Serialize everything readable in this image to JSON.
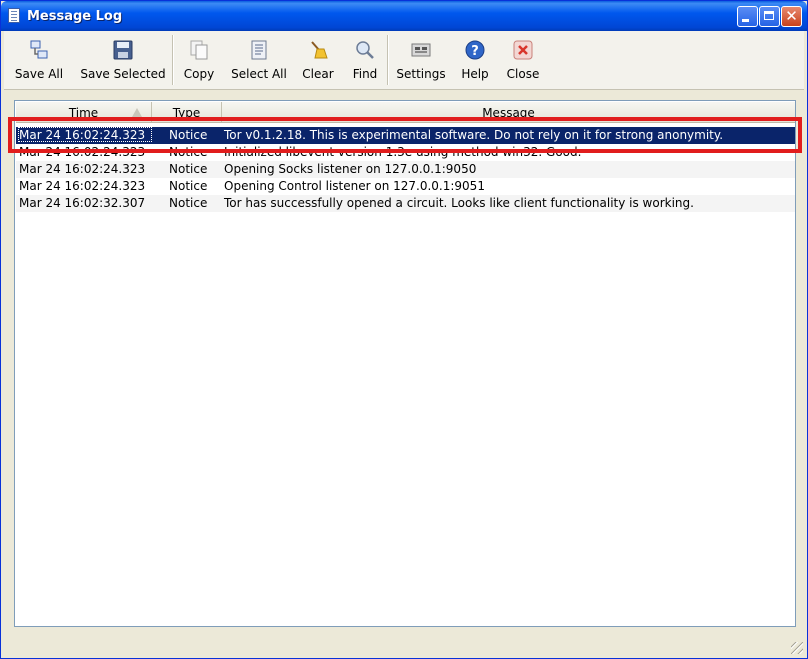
{
  "window": {
    "title": "Message Log"
  },
  "toolbar": {
    "save_all": "Save All",
    "save_selected": "Save Selected",
    "copy": "Copy",
    "select_all": "Select All",
    "clear": "Clear",
    "find": "Find",
    "settings": "Settings",
    "help": "Help",
    "close": "Close"
  },
  "table": {
    "columns": {
      "time": "Time",
      "type": "Type",
      "message": "Message"
    },
    "sort": {
      "column": "Time",
      "direction": "ascending"
    },
    "rows": [
      {
        "time": "Mar 24 16:02:24.323",
        "type": "Notice",
        "message": "Tor v0.1.2.18. This is experimental software. Do not rely on it for strong anonymity.",
        "selected": true
      },
      {
        "time": "Mar 24 16:02:24.323",
        "type": "Notice",
        "message": "Initialized libevent version 1.3e using method win32. Good."
      },
      {
        "time": "Mar 24 16:02:24.323",
        "type": "Notice",
        "message": "Opening Socks listener on 127.0.0.1:9050"
      },
      {
        "time": "Mar 24 16:02:24.323",
        "type": "Notice",
        "message": "Opening Control listener on 127.0.0.1:9051"
      },
      {
        "time": "Mar 24 16:02:32.307",
        "type": "Notice",
        "message": "Tor has successfully opened a circuit. Looks like client functionality is working."
      }
    ]
  },
  "colors": {
    "selection": "#0a246a",
    "highlight": "#e11d1d",
    "titlebar": "#0058ee"
  }
}
